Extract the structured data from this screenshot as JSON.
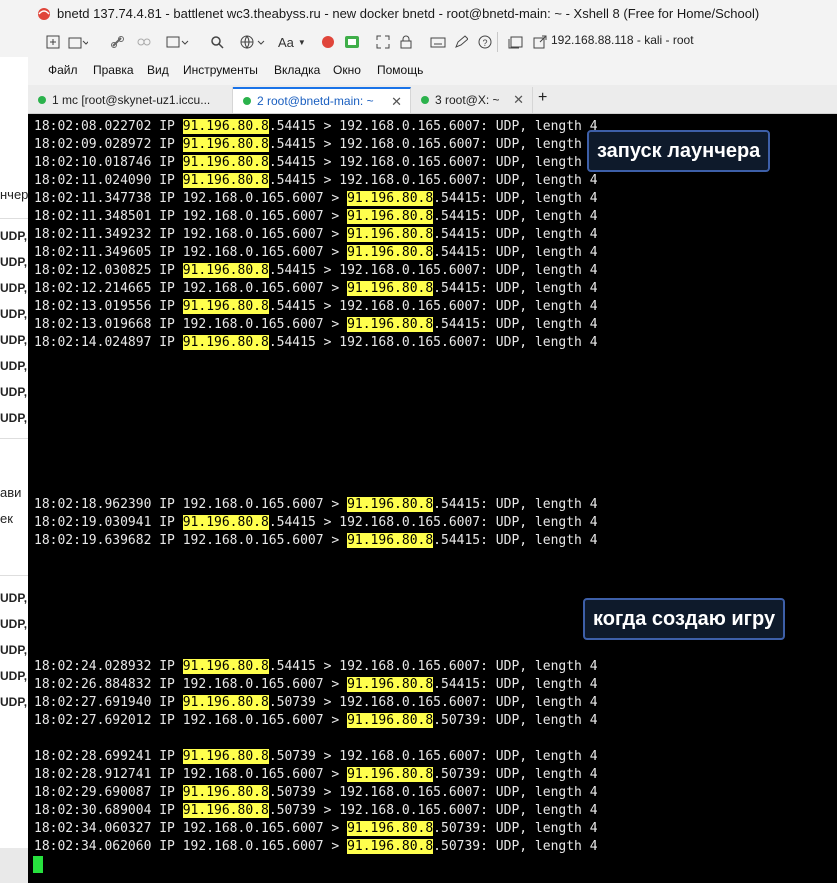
{
  "window": {
    "title": "bnetd 137.74.4.81  - battlenet  wc3.theabyss.ru - new docker bnetd - root@bnetd-main: ~ - Xshell 8 (Free for Home/School)"
  },
  "toolbar": {
    "address": "192.168.88.118 - kali - root",
    "font_label": "Aa"
  },
  "menu": [
    "Файл",
    "Правка",
    "Вид",
    "Инструменты",
    "Вкладка",
    "Окно",
    "Помощь"
  ],
  "tabs": [
    {
      "label": "1 mc [root@skynet-uz1.iccu...",
      "active": false
    },
    {
      "label": "2 root@bnetd-main: ~",
      "active": true
    },
    {
      "label": "3 root@X: ~",
      "active": false
    }
  ],
  "left_panel": {
    "fragments": [
      "нчер",
      "ави",
      "ек"
    ],
    "udp_label": "UDP,"
  },
  "terminal": {
    "lines": [
      {
        "t": "18:02:08.022702 IP ",
        "a": "91.196.80.8",
        "b": ".54415 > 192.168.0.165.6007: UDP, length 4",
        "c": "",
        "d": ""
      },
      {
        "t": "18:02:09.028972 IP ",
        "a": "91.196.80.8",
        "b": ".54415 > 192.168.0.165.6007: UDP, length 4",
        "c": "",
        "d": ""
      },
      {
        "t": "18:02:10.018746 IP ",
        "a": "91.196.80.8",
        "b": ".54415 > 192.168.0.165.6007: UDP, length 4",
        "c": "",
        "d": ""
      },
      {
        "t": "18:02:11.024090 IP ",
        "a": "91.196.80.8",
        "b": ".54415 > 192.168.0.165.6007: UDP, length 4",
        "c": "",
        "d": ""
      },
      {
        "t": "18:02:11.347738 IP 192.168.0.165.6007 > ",
        "a": "91.196.80.8",
        "b": ".54415: UDP, length 4",
        "c": "",
        "d": ""
      },
      {
        "t": "18:02:11.348501 IP 192.168.0.165.6007 > ",
        "a": "91.196.80.8",
        "b": ".54415: UDP, length 4",
        "c": "",
        "d": ""
      },
      {
        "t": "18:02:11.349232 IP 192.168.0.165.6007 > ",
        "a": "91.196.80.8",
        "b": ".54415: UDP, length 4",
        "c": "",
        "d": ""
      },
      {
        "t": "18:02:11.349605 IP 192.168.0.165.6007 > ",
        "a": "91.196.80.8",
        "b": ".54415: UDP, length 4",
        "c": "",
        "d": ""
      },
      {
        "t": "18:02:12.030825 IP ",
        "a": "91.196.80.8",
        "b": ".54415 > 192.168.0.165.6007: UDP, length 4",
        "c": "",
        "d": ""
      },
      {
        "t": "18:02:12.214665 IP 192.168.0.165.6007 > ",
        "a": "91.196.80.8",
        "b": ".54415: UDP, length 4",
        "c": "",
        "d": ""
      },
      {
        "t": "18:02:13.019556 IP ",
        "a": "91.196.80.8",
        "b": ".54415 > 192.168.0.165.6007: UDP, length 4",
        "c": "",
        "d": ""
      },
      {
        "t": "18:02:13.019668 IP 192.168.0.165.6007 > ",
        "a": "91.196.80.8",
        "b": ".54415: UDP, length 4",
        "c": "",
        "d": ""
      },
      {
        "t": "18:02:14.024897 IP ",
        "a": "91.196.80.8",
        "b": ".54415 > 192.168.0.165.6007: UDP, length 4",
        "c": "",
        "d": ""
      },
      {
        "t": "18:02:18.962390 IP 192.168.0.165.6007 > ",
        "a": "91.196.80.8",
        "b": ".54415: UDP, length 4",
        "c": "",
        "d": ""
      },
      {
        "t": "18:02:19.030941 IP ",
        "a": "91.196.80.8",
        "b": ".54415 > 192.168.0.165.6007: UDP, length 4",
        "c": "",
        "d": ""
      },
      {
        "t": "18:02:19.639682 IP 192.168.0.165.6007 > ",
        "a": "91.196.80.8",
        "b": ".54415: UDP, length 4",
        "c": "",
        "d": ""
      },
      {
        "t": "18:02:24.028932 IP ",
        "a": "91.196.80.8",
        "b": ".54415 > 192.168.0.165.6007: UDP, length 4",
        "c": "",
        "d": ""
      },
      {
        "t": "18:02:26.884832 IP 192.168.0.165.6007 > ",
        "a": "91.196.80.8",
        "b": ".54415: UDP, length 4",
        "c": "",
        "d": ""
      },
      {
        "t": "18:02:27.691940 IP ",
        "a": "91.196.80.8",
        "b": ".50739 > 192.168.0.165.6007: UDP, length 4",
        "c": "",
        "d": ""
      },
      {
        "t": "18:02:27.692012 IP 192.168.0.165.6007 > ",
        "a": "91.196.80.8",
        "b": ".50739: UDP, length 4",
        "c": "",
        "d": ""
      },
      {
        "t": "18:02:28.699241 IP ",
        "a": "91.196.80.8",
        "b": ".50739 > 192.168.0.165.6007: UDP, length 4",
        "c": "",
        "d": ""
      },
      {
        "t": "18:02:28.912741 IP 192.168.0.165.6007 > ",
        "a": "91.196.80.8",
        "b": ".50739: UDP, length 4",
        "c": "",
        "d": ""
      },
      {
        "t": "18:02:29.690087 IP ",
        "a": "91.196.80.8",
        "b": ".50739 > 192.168.0.165.6007: UDP, length 4",
        "c": "",
        "d": ""
      },
      {
        "t": "18:02:30.689004 IP ",
        "a": "91.196.80.8",
        "b": ".50739 > 192.168.0.165.6007: UDP, length 4",
        "c": "",
        "d": ""
      },
      {
        "t": "18:02:34.060327 IP 192.168.0.165.6007 > ",
        "a": "91.196.80.8",
        "b": ".50739: UDP, length 4",
        "c": "",
        "d": ""
      },
      {
        "t": "18:02:34.062060 IP 192.168.0.165.6007 > ",
        "a": "91.196.80.8",
        "b": ".50739: UDP, length 4",
        "c": "",
        "d": ""
      }
    ]
  },
  "annotations": {
    "launcher": "запуск лаунчера",
    "create_game": "когда создаю игру"
  }
}
